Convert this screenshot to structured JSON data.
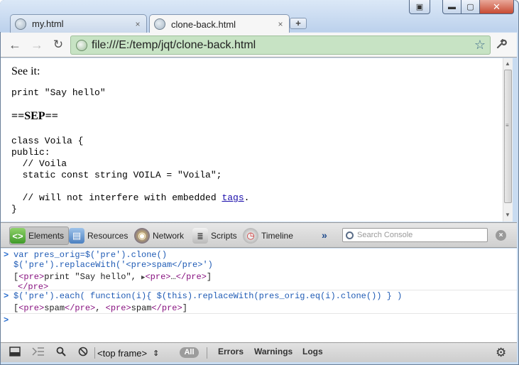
{
  "tabs": [
    {
      "label": "my.html",
      "close": "×"
    },
    {
      "label": "clone-back.html",
      "close": "×"
    }
  ],
  "newtab": "+",
  "window_controls": {
    "pin": "▣",
    "minimize": "▬",
    "maximize": "▢",
    "close": "✕"
  },
  "toolbar": {
    "back": "←",
    "forward": "→",
    "reload": "↻",
    "url": "file:///E:/temp/jqt/clone-back.html",
    "star": "☆",
    "wrench": "🔧"
  },
  "page": {
    "see_it": "See it:",
    "pre1": "print \"Say hello\"",
    "sep": "==SEP==",
    "pre2_lines": [
      "class Voila {",
      "public:",
      "  // Voila",
      "  static const string VOILA = \"Voila\";",
      "",
      "  // will not interfere with embedded "
    ],
    "pre2_link": "tags",
    "pre2_link_after": ".",
    "pre2_end": "}"
  },
  "devtools": {
    "tabs": [
      "Elements",
      "Resources",
      "Network",
      "Scripts",
      "Timeline"
    ],
    "more": "»",
    "search_placeholder": "Search Console",
    "clear": "×"
  },
  "console": {
    "prompt": ">",
    "entry1_cmd_line1": "var pres_orig=$('pre').clone()",
    "entry1_cmd_line2": "$('pre').replaceWith('<pre>spam</pre>')",
    "entry1_res_open": "[",
    "entry1_res_tag1": "<pre>",
    "entry1_res_text1": "print \"Say hello\", ",
    "entry1_res_arrow": "▶",
    "entry1_res_tag2": "<pre>",
    "entry1_res_text2": "…",
    "entry1_res_tag3": "</pre>",
    "entry1_res_close": "]",
    "entry1_res_line2": "</pre>",
    "entry2_cmd": "$('pre').each( function(i){ $(this).replaceWith(pres_orig.eq(i).clone()) } )",
    "entry2_res_open": "[",
    "entry2_res_tag1": "<pre>",
    "entry2_res_text1": "spam",
    "entry2_res_tag2": "</pre>",
    "entry2_res_sep": ", ",
    "entry2_res_tag3": "<pre>",
    "entry2_res_text2": "spam",
    "entry2_res_tag4": "</pre>",
    "entry2_res_close": "]"
  },
  "statusbar": {
    "frame_selector": "<top frame>",
    "frame_arrow": "⇕",
    "all": "All",
    "filters": [
      "Errors",
      "Warnings",
      "Logs"
    ],
    "gear": "⚙"
  },
  "colors": {
    "omnibox_bg": "#c7e3c4",
    "console_cmd": "#1f5bb5",
    "tag": "#881280"
  }
}
